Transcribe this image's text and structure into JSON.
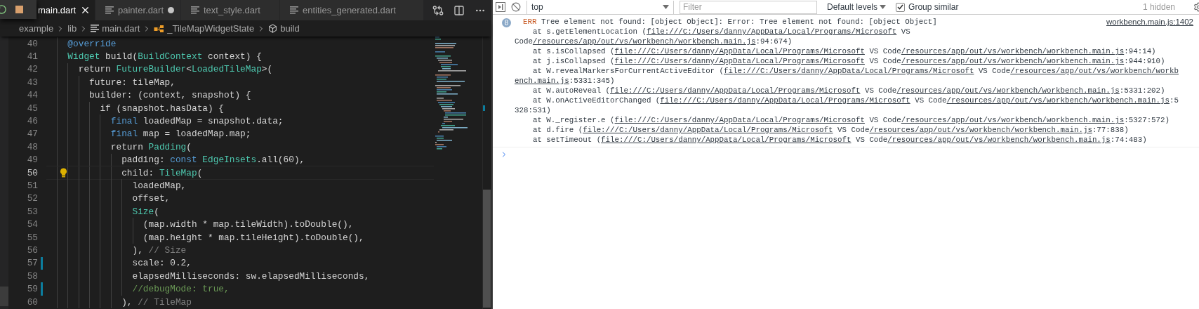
{
  "editor": {
    "tabs": [
      {
        "label": "main.dart",
        "selected": true,
        "modified": false
      },
      {
        "label": "painter.dart",
        "selected": false,
        "modified": true
      },
      {
        "label": "text_style.dart",
        "selected": false,
        "modified": false
      },
      {
        "label": "entities_generated.dart",
        "selected": false,
        "modified": false
      }
    ],
    "breadcrumbs": [
      {
        "label": "example",
        "kind": "folder"
      },
      {
        "label": "lib",
        "kind": "folder"
      },
      {
        "label": "main.dart",
        "kind": "file"
      },
      {
        "label": "_TileMapWidgetState",
        "kind": "class"
      },
      {
        "label": "build",
        "kind": "method"
      }
    ],
    "lines": [
      {
        "number": "40",
        "current": false,
        "modified": false,
        "lightbulb": false,
        "segments": [
          {
            "text": "  @override",
            "kind": "keyword"
          }
        ]
      },
      {
        "number": "41",
        "current": false,
        "modified": false,
        "lightbulb": false,
        "segments": [
          {
            "text": "  Widget",
            "kind": "type"
          },
          {
            "text": " build(",
            "kind": "plain"
          },
          {
            "text": "BuildContext",
            "kind": "type"
          },
          {
            "text": " context) {",
            "kind": "plain"
          }
        ]
      },
      {
        "number": "42",
        "current": false,
        "modified": false,
        "lightbulb": false,
        "segments": [
          {
            "text": "    return ",
            "kind": "plain"
          },
          {
            "text": "FutureBuilder",
            "kind": "type"
          },
          {
            "text": "<",
            "kind": "plain"
          },
          {
            "text": "LoadedTileMap",
            "kind": "type"
          },
          {
            "text": ">(",
            "kind": "plain"
          }
        ]
      },
      {
        "number": "43",
        "current": false,
        "modified": false,
        "lightbulb": false,
        "segments": [
          {
            "text": "      future: tileMap,",
            "kind": "plain"
          }
        ]
      },
      {
        "number": "44",
        "current": false,
        "modified": false,
        "lightbulb": false,
        "segments": [
          {
            "text": "      builder: (context, snapshot) {",
            "kind": "plain"
          }
        ]
      },
      {
        "number": "45",
        "current": false,
        "modified": false,
        "lightbulb": false,
        "segments": [
          {
            "text": "        if (snapshot.hasData) {",
            "kind": "plain"
          }
        ]
      },
      {
        "number": "46",
        "current": false,
        "modified": false,
        "lightbulb": false,
        "segments": [
          {
            "text": "          final",
            "kind": "keyword"
          },
          {
            "text": " loadedMap = snapshot.data;",
            "kind": "plain"
          }
        ]
      },
      {
        "number": "47",
        "current": false,
        "modified": false,
        "lightbulb": false,
        "segments": [
          {
            "text": "          final",
            "kind": "keyword"
          },
          {
            "text": " map = loadedMap.map;",
            "kind": "plain"
          }
        ]
      },
      {
        "number": "48",
        "current": false,
        "modified": false,
        "lightbulb": false,
        "segments": [
          {
            "text": "          return ",
            "kind": "plain"
          },
          {
            "text": "Padding",
            "kind": "type"
          },
          {
            "text": "(",
            "kind": "plain"
          }
        ]
      },
      {
        "number": "49",
        "current": false,
        "modified": false,
        "lightbulb": false,
        "segments": [
          {
            "text": "            padding: ",
            "kind": "plain"
          },
          {
            "text": "const ",
            "kind": "keyword"
          },
          {
            "text": "EdgeInsets",
            "kind": "type"
          },
          {
            "text": ".all(60),",
            "kind": "plain"
          }
        ]
      },
      {
        "number": "50",
        "current": true,
        "modified": false,
        "lightbulb": true,
        "segments": [
          {
            "text": "            child: ",
            "kind": "plain"
          },
          {
            "text": "TileMap",
            "kind": "type"
          },
          {
            "text": "(",
            "kind": "plain"
          }
        ]
      },
      {
        "number": "51",
        "current": false,
        "modified": false,
        "lightbulb": false,
        "segments": [
          {
            "text": "              loadedMap,",
            "kind": "plain"
          }
        ]
      },
      {
        "number": "52",
        "current": false,
        "modified": false,
        "lightbulb": false,
        "segments": [
          {
            "text": "              offset,",
            "kind": "plain"
          }
        ]
      },
      {
        "number": "53",
        "current": false,
        "modified": false,
        "lightbulb": false,
        "segments": [
          {
            "text": "              Size",
            "kind": "type"
          },
          {
            "text": "(",
            "kind": "plain"
          }
        ]
      },
      {
        "number": "54",
        "current": false,
        "modified": false,
        "lightbulb": false,
        "segments": [
          {
            "text": "                (map.width * map.tileWidth).toDouble(),",
            "kind": "plain"
          }
        ]
      },
      {
        "number": "55",
        "current": false,
        "modified": false,
        "lightbulb": false,
        "segments": [
          {
            "text": "                (map.height * map.tileHeight).toDouble(),",
            "kind": "plain"
          }
        ]
      },
      {
        "number": "56",
        "current": false,
        "modified": false,
        "lightbulb": false,
        "segments": [
          {
            "text": "              ), ",
            "kind": "plain"
          },
          {
            "text": "// Size",
            "kind": "hint"
          }
        ]
      },
      {
        "number": "57",
        "current": false,
        "modified": true,
        "lightbulb": false,
        "segments": [
          {
            "text": "              scale: 0.2,",
            "kind": "plain"
          }
        ]
      },
      {
        "number": "58",
        "current": false,
        "modified": false,
        "lightbulb": false,
        "segments": [
          {
            "text": "              elapsedMilliseconds: sw.elapsedMilliseconds,",
            "kind": "plain"
          }
        ]
      },
      {
        "number": "59",
        "current": false,
        "modified": true,
        "lightbulb": false,
        "segments": [
          {
            "text": "              //debugMode: true,",
            "kind": "comment"
          }
        ]
      },
      {
        "number": "60",
        "current": false,
        "modified": false,
        "lightbulb": false,
        "segments": [
          {
            "text": "            ), ",
            "kind": "plain"
          },
          {
            "text": "// TileMap",
            "kind": "hint"
          }
        ]
      }
    ]
  },
  "console": {
    "toolbar": {
      "context": "top",
      "filter_placeholder": "Filter",
      "levels": "Default levels",
      "group_similar": {
        "label": "Group similar",
        "checked": true
      },
      "hidden": "1 hidden"
    },
    "message": {
      "count": "8",
      "level": "ERR",
      "source": "workbench.main.js:1402",
      "lines": [
        [
          {
            "text": " Tree element not found: [object Object]: Error: Tree element not found: [object Object]",
            "kind": "text"
          }
        ],
        [
          {
            "text": "    at s.getElementLocation (",
            "kind": "text"
          },
          {
            "text": "file:///C:/Users/danny/AppData/Local/Programs/Microsoft",
            "kind": "link"
          },
          {
            "text": " VS",
            "kind": "text"
          }
        ],
        [
          {
            "text": "Code",
            "kind": "text"
          },
          {
            "text": "/resources/app/out/vs/workbench/workbench.main.js",
            "kind": "link"
          },
          {
            "text": ":94:674)",
            "kind": "text"
          }
        ],
        [
          {
            "text": "    at s.isCollapsed (",
            "kind": "text"
          },
          {
            "text": "file:///C:/Users/danny/AppData/Local/Programs/Microsoft",
            "kind": "link"
          },
          {
            "text": " VS Code",
            "kind": "text"
          },
          {
            "text": "/resources/app/out/vs/workbench/workbench.main.js",
            "kind": "link"
          },
          {
            "text": ":94:14)",
            "kind": "text"
          }
        ],
        [
          {
            "text": "    at j.isCollapsed (",
            "kind": "text"
          },
          {
            "text": "file:///C:/Users/danny/AppData/Local/Programs/Microsoft",
            "kind": "link"
          },
          {
            "text": " VS Code",
            "kind": "text"
          },
          {
            "text": "/resources/app/out/vs/workbench/workbench.main.js",
            "kind": "link"
          },
          {
            "text": ":944:910)",
            "kind": "text"
          }
        ],
        [
          {
            "text": "    at W.revealMarkersForCurrentActiveEditor (",
            "kind": "text"
          },
          {
            "text": "file:///C:/Users/danny/AppData/Local/Programs/Microsoft",
            "kind": "link"
          },
          {
            "text": " VS Code",
            "kind": "text"
          },
          {
            "text": "/resources/app/out/vs/workbench/workb",
            "kind": "link"
          }
        ],
        [
          {
            "text": "ench.main.js",
            "kind": "link"
          },
          {
            "text": ":5331:345)",
            "kind": "text"
          }
        ],
        [
          {
            "text": "    at W.autoReveal (",
            "kind": "text"
          },
          {
            "text": "file:///C:/Users/danny/AppData/Local/Programs/Microsoft",
            "kind": "link"
          },
          {
            "text": " VS Code",
            "kind": "text"
          },
          {
            "text": "/resources/app/out/vs/workbench/workbench.main.js",
            "kind": "link"
          },
          {
            "text": ":5331:202)",
            "kind": "text"
          }
        ],
        [
          {
            "text": "    at W.onActiveEditorChanged (",
            "kind": "text"
          },
          {
            "text": "file:///C:/Users/danny/AppData/Local/Programs/Microsoft",
            "kind": "link"
          },
          {
            "text": " VS Code",
            "kind": "text"
          },
          {
            "text": "/resources/app/out/vs/workbench/workbench.main.js",
            "kind": "link"
          },
          {
            "text": ":5",
            "kind": "text"
          }
        ],
        [
          {
            "text": "328:531)",
            "kind": "text"
          }
        ],
        [
          {
            "text": "    at W._register.e (",
            "kind": "text"
          },
          {
            "text": "file:///C:/Users/danny/AppData/Local/Programs/Microsoft",
            "kind": "link"
          },
          {
            "text": " VS Code",
            "kind": "text"
          },
          {
            "text": "/resources/app/out/vs/workbench/workbench.main.js",
            "kind": "link"
          },
          {
            "text": ":5327:572)",
            "kind": "text"
          }
        ],
        [
          {
            "text": "    at d.fire (",
            "kind": "text"
          },
          {
            "text": "file:///C:/Users/danny/AppData/Local/Programs/Microsoft",
            "kind": "link"
          },
          {
            "text": " VS Code",
            "kind": "text"
          },
          {
            "text": "/resources/app/out/vs/workbench/workbench.main.js",
            "kind": "link"
          },
          {
            "text": ":77:838)",
            "kind": "text"
          }
        ],
        [
          {
            "text": "    at setTimeout (",
            "kind": "text"
          },
          {
            "text": "file:///C:/Users/danny/AppData/Local/Programs/Microsoft",
            "kind": "link"
          },
          {
            "text": " VS Code",
            "kind": "text"
          },
          {
            "text": "/resources/app/out/vs/workbench/workbench.main.js",
            "kind": "link"
          },
          {
            "text": ":74:483)",
            "kind": "text"
          }
        ]
      ]
    }
  }
}
